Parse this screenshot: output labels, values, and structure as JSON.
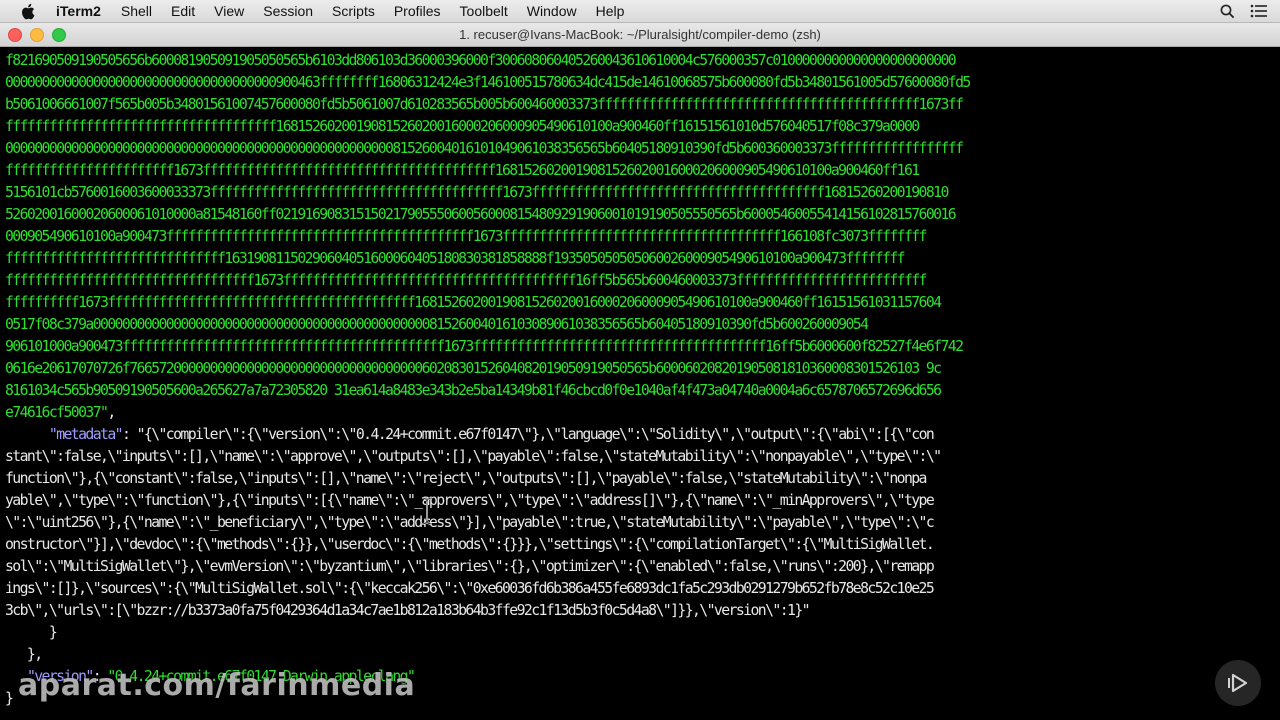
{
  "menubar": {
    "app_name": "iTerm2",
    "items": [
      "Shell",
      "Edit",
      "View",
      "Session",
      "Scripts",
      "Profiles",
      "Toolbelt",
      "Window",
      "Help"
    ]
  },
  "window": {
    "title": "1. recuser@Ivans-MacBook: ~/Pluralsight/compiler-demo (zsh)"
  },
  "terminal": {
    "lines": [
      [
        [
          "f821690509190505656b600081905091905050565b6103dd806103d36000396000f300608060405260043610610004c576000357c0100000000000000000000000",
          ""
        ]
      ],
      [
        [
          "0000000000000000000000000000000000000900463ffffffff16806312424e3f146100515780634dc415de14610068575b600080fd5b34801561005d57600080fd5",
          ""
        ]
      ],
      [
        [
          "b5061006661007f565b005b34801561007457600080fd5b5061007d610283565b005b600460003373ffffffffffffffffffffffffffffffffffffffffffff1673ff",
          ""
        ]
      ],
      [
        [
          "fffffffffffffffffffffffffffffffffffff1681526020019081526020016000206000905490610100a900460ff16151561010d576040517f08c379a0000",
          ""
        ]
      ],
      [
        [
          "0000000000000000000000000000000000000000000000000000081526004016101049061038356565b60405180910390fd5b600360003373ffffffffffffffffff",
          ""
        ]
      ],
      [
        [
          "fffffffffffffffffffffff1673ffffffffffffffffffffffffffffffffffffffff1681526020019081526020016000206000905490610100a900460ff161",
          ""
        ]
      ],
      [
        [
          "5156101cb5760016003600033373ffffffffffffffffffffffffffffffffffffffff1673ffffffffffffffffffffffffffffffffffffffff16815260200190810",
          ""
        ]
      ],
      [
        [
          "52602001600020600061010000a81548160ff021916908315150217905550600560008154809291906001019190505550565b60005460055414156102815760016",
          ""
        ]
      ],
      [
        [
          "000905490610100a900473ffffffffffffffffffffffffffffffffffffffffff1673ffffffffffffffffffffffffffffffffffffff166108fc3073ffffffff",
          ""
        ]
      ],
      [
        [
          "ffffffffffffffffffffffffffffff16319081150290604051600060405180830381858888f193505050505060026000905490610100a900473ffffffff",
          ""
        ]
      ],
      [
        [
          "ffffffffffffffffffffffffffffffffff1673ffffffffffffffffffffffffffffffffffffffff16ff5b565b600460003373ffffffffffffffffffffffffff",
          ""
        ]
      ],
      [
        [
          "ffffffffff1673ffffffffffffffffffffffffffffffffffffffffff1681526020019081526020016000206000905490610100a900460ff16151561031157604",
          ""
        ]
      ],
      [
        [
          "0517f08c379a000000000000000000000000000000000000000000000081526004016103089061038356565b60405180910390fd5b600260009054",
          ""
        ]
      ],
      [
        [
          "906101000a900473ffffffffffffffffffffffffffffffffffffffffffff1673ffffffffffffffffffffffffffffffffffffffff16ff5b6000600f82527f4e6f742",
          ""
        ]
      ],
      [
        [
          "0616e20617070726f76657200000000000000000000000000000000006020830152604082019050919050565b600060208201905081810360008301526103 9c",
          ""
        ]
      ],
      [
        [
          "8161034c565b90509190505600a265627a7a72305820 31ea614a8483e343b2e5ba14349b81f46cbcd0f0e1040af4f473a04740a0004a6c6578706572696d656",
          ""
        ]
      ],
      [
        [
          "e74616cf50037\"",
          ""
        ],
        [
          ",",
          "w"
        ]
      ],
      [
        [
          "      ",
          ""
        ],
        [
          "\"metadata\"",
          "k"
        ],
        [
          ": ",
          "w"
        ],
        [
          "\"{\\\"compiler\\\":{\\\"version\\\":\\\"0.4.24+commit.e67f0147\\\"},\\\"language\\\":\\\"Solidity\\\",\\\"output\\\":{\\\"abi\\\":[{\\\"con",
          "w"
        ]
      ],
      [
        [
          "stant\\\":false,\\\"inputs\\\":[],\\\"name\\\":\\\"approve\\\",\\\"outputs\\\":[],\\\"payable\\\":false,\\\"stateMutability\\\":\\\"nonpayable\\\",\\\"type\\\":\\\"",
          "w"
        ]
      ],
      [
        [
          "function\\\"},{\\\"constant\\\":false,\\\"inputs\\\":[],\\\"name\\\":\\\"reject\\\",\\\"outputs\\\":[],\\\"payable\\\":false,\\\"stateMutability\\\":\\\"nonpa",
          "w"
        ]
      ],
      [
        [
          "yable\\\",\\\"type\\\":\\\"function\\\"},{\\\"inputs\\\":[{\\\"name\\\":\\\"_approvers\\\",\\\"type\\\":\\\"address[]\\\"},{\\\"name\\\":\\\"_minApprovers\\\",\\\"type",
          "w"
        ]
      ],
      [
        [
          "\\\":\\\"uint256\\\"},{\\\"name\\\":\\\"_beneficiary\\\",\\\"type\\\":\\\"address\\\"}],\\\"payable\\\":true,\\\"stateMutability\\\":\\\"payable\\\",\\\"type\\\":\\\"c",
          "w"
        ]
      ],
      [
        [
          "onstructor\\\"}],\\\"devdoc\\\":{\\\"methods\\\":{}},\\\"userdoc\\\":{\\\"methods\\\":{}}},\\\"settings\\\":{\\\"compilationTarget\\\":{\\\"MultiSigWallet.",
          "w"
        ]
      ],
      [
        [
          "sol\\\":\\\"MultiSigWallet\\\"},\\\"evmVersion\\\":\\\"byzantium\\\",\\\"libraries\\\":{},\\\"optimizer\\\":{\\\"enabled\\\":false,\\\"runs\\\":200},\\\"remapp",
          "w"
        ]
      ],
      [
        [
          "ings\\\":[]},\\\"sources\\\":{\\\"MultiSigWallet.sol\\\":{\\\"keccak256\\\":\\\"0xe60036fd6b386a455fe6893dc1fa5c293db0291279b652fb78e8c52c10e25",
          "w"
        ]
      ],
      [
        [
          "3cb\\\",\\\"urls\\\":[\\\"bzzr://b3373a0fa75f0429364d1a34c7ae1b812a183b64b3ffe92c1f13d5b3f0c5d4a8\\\"]}},\\\"version\\\":1}\"",
          "w"
        ]
      ],
      [
        [
          "      }",
          "w"
        ]
      ],
      [
        [
          "   },",
          "w"
        ]
      ],
      [
        [
          "   ",
          ""
        ],
        [
          "\"version\"",
          "k"
        ],
        [
          ": ",
          "w"
        ],
        [
          "\"0.4.24+commit.e67f0147.Darwin.appleclang\"",
          ""
        ]
      ],
      [
        [
          "}",
          "w"
        ]
      ]
    ]
  },
  "watermark": "aparat.com/farinmedia",
  "colors": {
    "terminal_bg": "#000000",
    "terminal_green": "#2ee02e",
    "terminal_white": "#e8e8e8",
    "json_key": "#9f9cff",
    "close": "#fc605c",
    "minimize": "#fdbc40",
    "zoom": "#34c84a"
  },
  "icons": [
    "apple-icon",
    "spotlight-search-icon",
    "notification-center-icon",
    "close-icon",
    "minimize-icon",
    "zoom-icon",
    "text-cursor-icon",
    "play-icon"
  ]
}
